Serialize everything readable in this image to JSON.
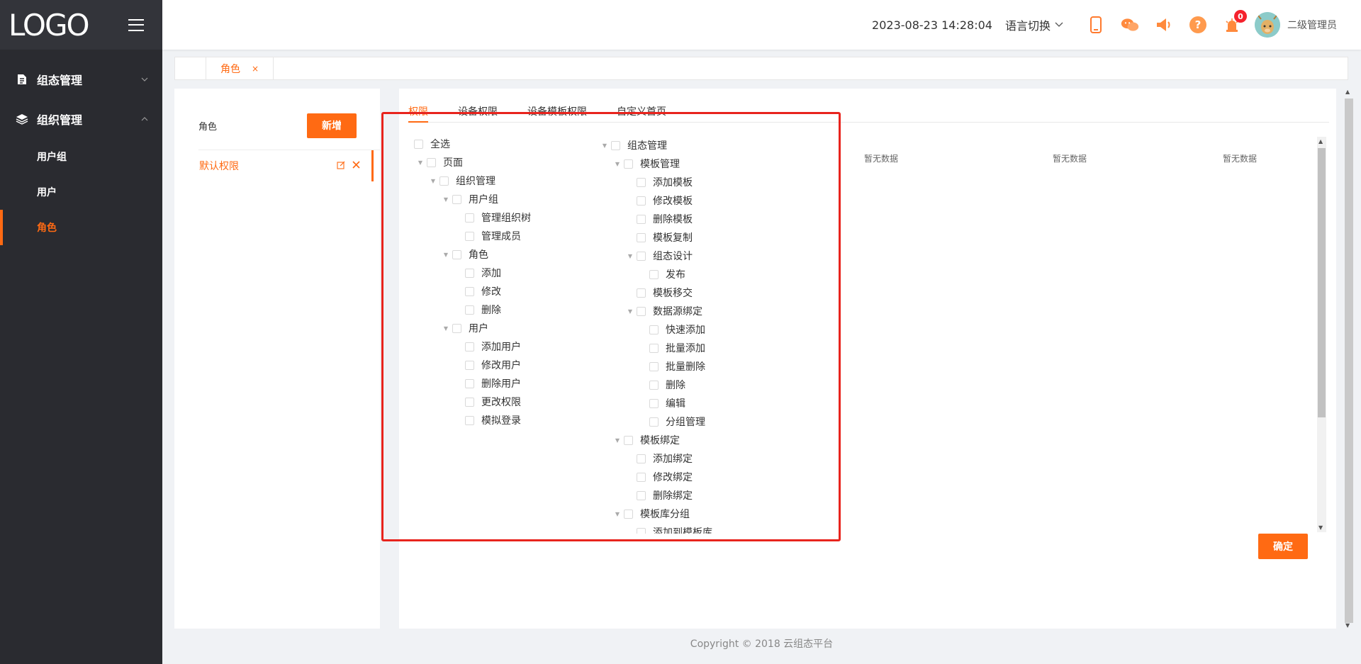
{
  "sidebar": {
    "logo": "LOGO",
    "groups": [
      {
        "label": "组态管理",
        "expanded": false,
        "items": []
      },
      {
        "label": "组织管理",
        "expanded": true,
        "items": [
          {
            "label": "用户组",
            "active": false
          },
          {
            "label": "用户",
            "active": false
          },
          {
            "label": "角色",
            "active": true
          }
        ]
      }
    ]
  },
  "header": {
    "datetime": "2023-08-23 14:28:04",
    "language": "语言切换",
    "notification_count": "0",
    "user": "二级管理员"
  },
  "tabs": [
    {
      "label": "角色",
      "close": "×"
    }
  ],
  "left_panel": {
    "title": "角色",
    "add_button": "新增",
    "roles": [
      {
        "name": "默认权限"
      }
    ]
  },
  "main": {
    "tabs": [
      {
        "label": "权限",
        "active": true
      },
      {
        "label": "设备权限",
        "active": false
      },
      {
        "label": "设备模板权限",
        "active": false
      },
      {
        "label": "自定义首页",
        "active": false
      }
    ],
    "no_data": [
      "暂无数据",
      "暂无数据",
      "暂无数据"
    ],
    "confirm_button": "确定"
  },
  "tree_left": [
    {
      "label": "全选",
      "level": 0,
      "caret": false
    },
    {
      "label": "页面",
      "level": 1,
      "caret": true
    },
    {
      "label": "组织管理",
      "level": 2,
      "caret": true
    },
    {
      "label": "用户组",
      "level": 3,
      "caret": true
    },
    {
      "label": "管理组织树",
      "level": 4,
      "caret": false
    },
    {
      "label": "管理成员",
      "level": 4,
      "caret": false
    },
    {
      "label": "角色",
      "level": 3,
      "caret": true
    },
    {
      "label": "添加",
      "level": 4,
      "caret": false
    },
    {
      "label": "修改",
      "level": 4,
      "caret": false
    },
    {
      "label": "删除",
      "level": 4,
      "caret": false
    },
    {
      "label": "用户",
      "level": 3,
      "caret": true
    },
    {
      "label": "添加用户",
      "level": 4,
      "caret": false
    },
    {
      "label": "修改用户",
      "level": 4,
      "caret": false
    },
    {
      "label": "删除用户",
      "level": 4,
      "caret": false
    },
    {
      "label": "更改权限",
      "level": 4,
      "caret": false
    },
    {
      "label": "模拟登录",
      "level": 4,
      "caret": false
    }
  ],
  "tree_right": [
    {
      "label": "组态管理",
      "level": 0,
      "caret": true
    },
    {
      "label": "模板管理",
      "level": 1,
      "caret": true
    },
    {
      "label": "添加模板",
      "level": 2,
      "caret": false
    },
    {
      "label": "修改模板",
      "level": 2,
      "caret": false
    },
    {
      "label": "删除模板",
      "level": 2,
      "caret": false
    },
    {
      "label": "模板复制",
      "level": 2,
      "caret": false
    },
    {
      "label": "组态设计",
      "level": 2,
      "caret": true
    },
    {
      "label": "发布",
      "level": 3,
      "caret": false
    },
    {
      "label": "模板移交",
      "level": 2,
      "caret": false
    },
    {
      "label": "数据源绑定",
      "level": 2,
      "caret": true
    },
    {
      "label": "快速添加",
      "level": 3,
      "caret": false
    },
    {
      "label": "批量添加",
      "level": 3,
      "caret": false
    },
    {
      "label": "批量删除",
      "level": 3,
      "caret": false
    },
    {
      "label": "删除",
      "level": 3,
      "caret": false
    },
    {
      "label": "编辑",
      "level": 3,
      "caret": false
    },
    {
      "label": "分组管理",
      "level": 3,
      "caret": false
    },
    {
      "label": "模板绑定",
      "level": 1,
      "caret": true
    },
    {
      "label": "添加绑定",
      "level": 2,
      "caret": false
    },
    {
      "label": "修改绑定",
      "level": 2,
      "caret": false
    },
    {
      "label": "删除绑定",
      "level": 2,
      "caret": false
    },
    {
      "label": "模板库分组",
      "level": 1,
      "caret": true
    },
    {
      "label": "添加到模板库",
      "level": 2,
      "caret": false
    }
  ],
  "footer": "Copyright © 2018 云组态平台",
  "colors": {
    "accent": "#ff6a13",
    "sidebar": "#2a2b30",
    "highlight": "#e8241d"
  }
}
